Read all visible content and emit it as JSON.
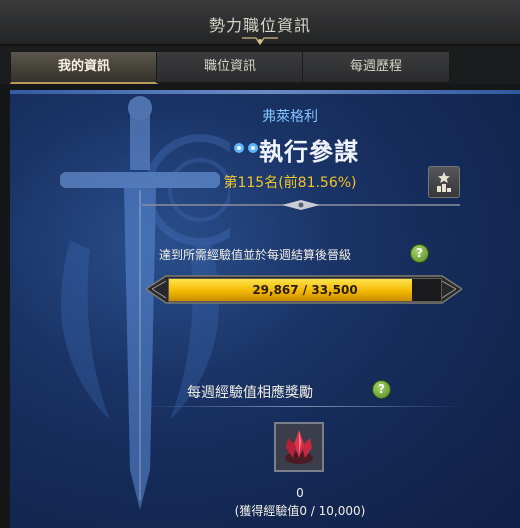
{
  "window": {
    "title": "勢力職位資訊"
  },
  "tabs": [
    {
      "label": "我的資訊",
      "active": true
    },
    {
      "label": "職位資訊",
      "active": false
    },
    {
      "label": "每週歷程",
      "active": false
    }
  ],
  "profile": {
    "faction": "弗萊格利",
    "rank_title": "執行參謀",
    "rank_position": "第115名(前81.56%)"
  },
  "progress": {
    "goal_text": "達到所需經驗值並於每週結算後晉級",
    "help_label": "?",
    "current": 29867,
    "required": 33500,
    "display_text": "29,867 / 33,500",
    "fraction": 0.8916
  },
  "reward": {
    "title": "每週經驗值相應獎勵",
    "help_label": "?",
    "item_icon": "red-crystal-icon",
    "count": "0",
    "exp_text": "(獲得經驗值0 / 10,000)"
  },
  "colors": {
    "accent_gold": "#f0c52a",
    "faction_blue": "#7fc4ff",
    "bar_fill": "#f2b800",
    "help_green": "#6aa53a"
  }
}
